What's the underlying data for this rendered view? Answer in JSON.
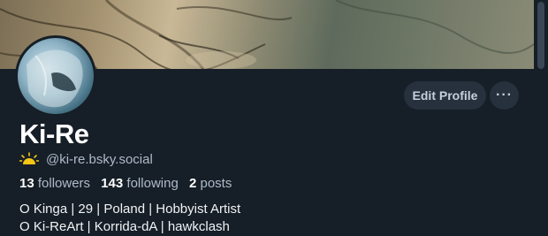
{
  "profile": {
    "display_name": "Ki-Re",
    "handle": "@ki-re.bsky.social",
    "stats": {
      "followers_count": "13",
      "followers_label": "followers",
      "following_count": "143",
      "following_label": "following",
      "posts_count": "2",
      "posts_label": "posts"
    },
    "bio_lines": [
      "O Kinga | 29 | Poland | Hobbyist Artist",
      "O Ki-ReArt | Korrida-dA | hawkclash"
    ]
  },
  "actions": {
    "edit_label": "Edit Profile",
    "more_label": "···"
  },
  "icons": {
    "handle_prefix_icon": "sun-icon",
    "more_icon": "ellipsis-icon"
  },
  "colors": {
    "background": "#161e27",
    "button_bg": "#26313d",
    "muted_text": "#aebbc9",
    "sun": "#f5c518"
  }
}
